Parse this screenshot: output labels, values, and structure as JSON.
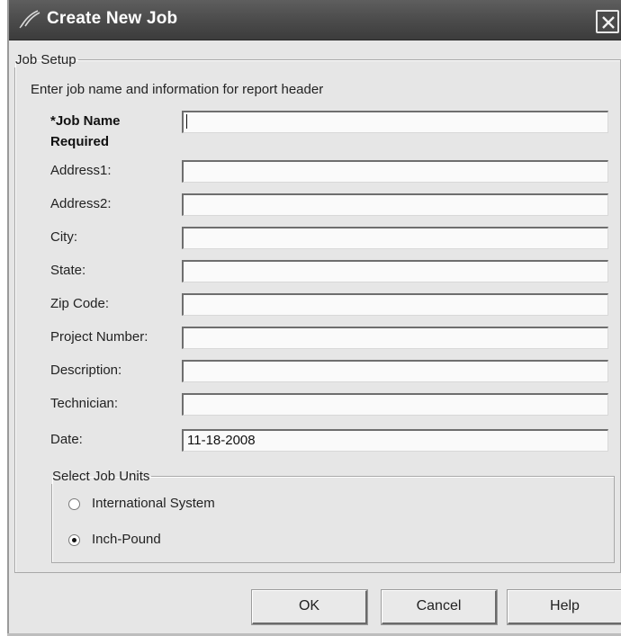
{
  "window": {
    "title": "Create New Job",
    "close_glyph": "X"
  },
  "job_setup": {
    "legend": "Job Setup",
    "intro": "Enter job name and information for report header",
    "fields": [
      {
        "label": "*Job Name Required",
        "value": "",
        "required": true
      },
      {
        "label": "Address1:",
        "value": ""
      },
      {
        "label": "Address2:",
        "value": ""
      },
      {
        "label": "City:",
        "value": ""
      },
      {
        "label": "State:",
        "value": ""
      },
      {
        "label": "Zip Code:",
        "value": ""
      },
      {
        "label": "Project Number:",
        "value": ""
      },
      {
        "label": "Description:",
        "value": ""
      },
      {
        "label": "Technician:",
        "value": ""
      },
      {
        "label": "Date:",
        "value": "11-18-2008"
      }
    ]
  },
  "units": {
    "legend": "Select Job Units",
    "options": [
      {
        "label": "International System",
        "selected": false
      },
      {
        "label": "Inch-Pound",
        "selected": true
      }
    ]
  },
  "buttons": {
    "ok": "OK",
    "cancel": "Cancel",
    "help": "Help"
  },
  "icons": {
    "app": "feather-quill-icon",
    "close": "close-icon"
  },
  "colors": {
    "titlebar": "#4a4a4a",
    "dialog_bg": "#e6e6e6",
    "field_bg": "#fafafa"
  }
}
